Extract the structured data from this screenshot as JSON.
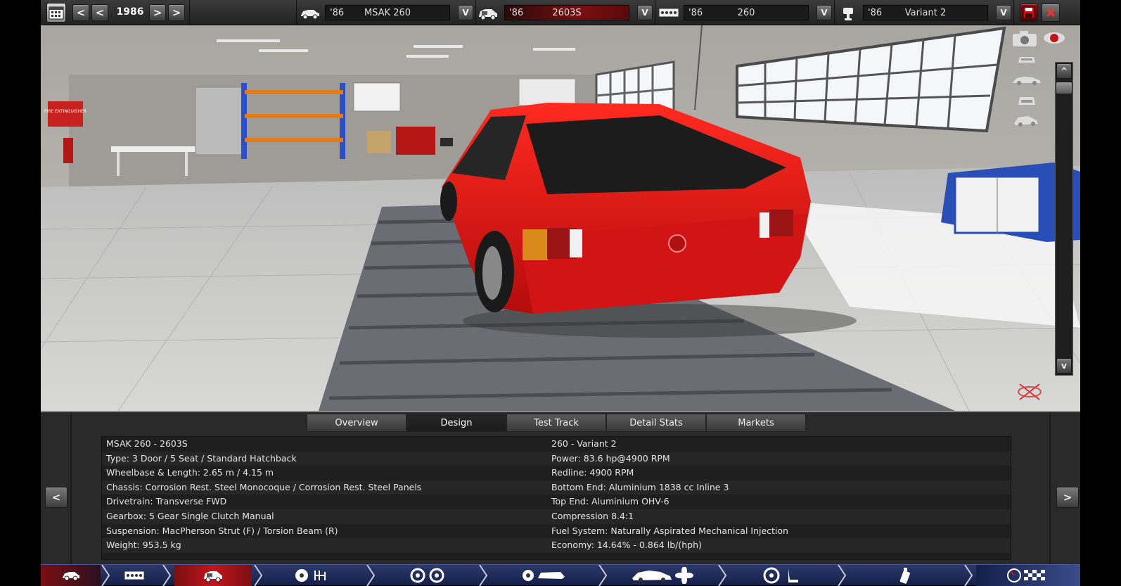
{
  "toolbar": {
    "year": "1986",
    "prev_fast": "<",
    "prev": "<",
    "next": ">",
    "next_fast": ">",
    "model": {
      "year": "'86",
      "name": "MSAK 260"
    },
    "trim": {
      "year": "'86",
      "name": "2603S"
    },
    "engine": {
      "year": "'86",
      "name": "260"
    },
    "variant": {
      "year": "'86",
      "name": "Variant 2"
    },
    "dropdown_label": "V"
  },
  "camera": {
    "up": "^",
    "down": "v"
  },
  "tabs": [
    "Overview",
    "Design",
    "Test Track",
    "Detail Stats",
    "Markets"
  ],
  "active_tab": "Design",
  "stats": {
    "left": [
      "MSAK 260 - 2603S",
      "Type: 3 Door / 5 Seat / Standard Hatchback",
      "Wheelbase & Length: 2.65 m / 4.15 m",
      "Chassis: Corrosion Rest. Steel Monocoque / Corrosion Rest. Steel Panels",
      "Drivetrain: Transverse FWD",
      "Gearbox: 5 Gear Single Clutch Manual",
      "Suspension: MacPherson Strut (F) / Torsion Beam (R)",
      "Weight: 953.5 kg"
    ],
    "right": [
      "260 - Variant 2",
      "Power: 83.6 hp@4900 RPM",
      "Redline: 4900 RPM",
      "Bottom End: Aluminium 1838 cc Inline 3",
      "Top End: Aluminium OHV-6",
      "Compression 8.4:1",
      "Fuel System: Naturally Aspirated Mechanical Injection",
      "Economy: 14.64% - 0.864 lb/(hph)"
    ]
  },
  "nav_arrows": {
    "prev": "<",
    "next": ">"
  },
  "scene_sign": "FIRE EXTINGUISHER",
  "colors": {
    "accent_red": "#c2151b",
    "car_red": "#e01a1a",
    "nav_blue": "#1c2a5a"
  }
}
